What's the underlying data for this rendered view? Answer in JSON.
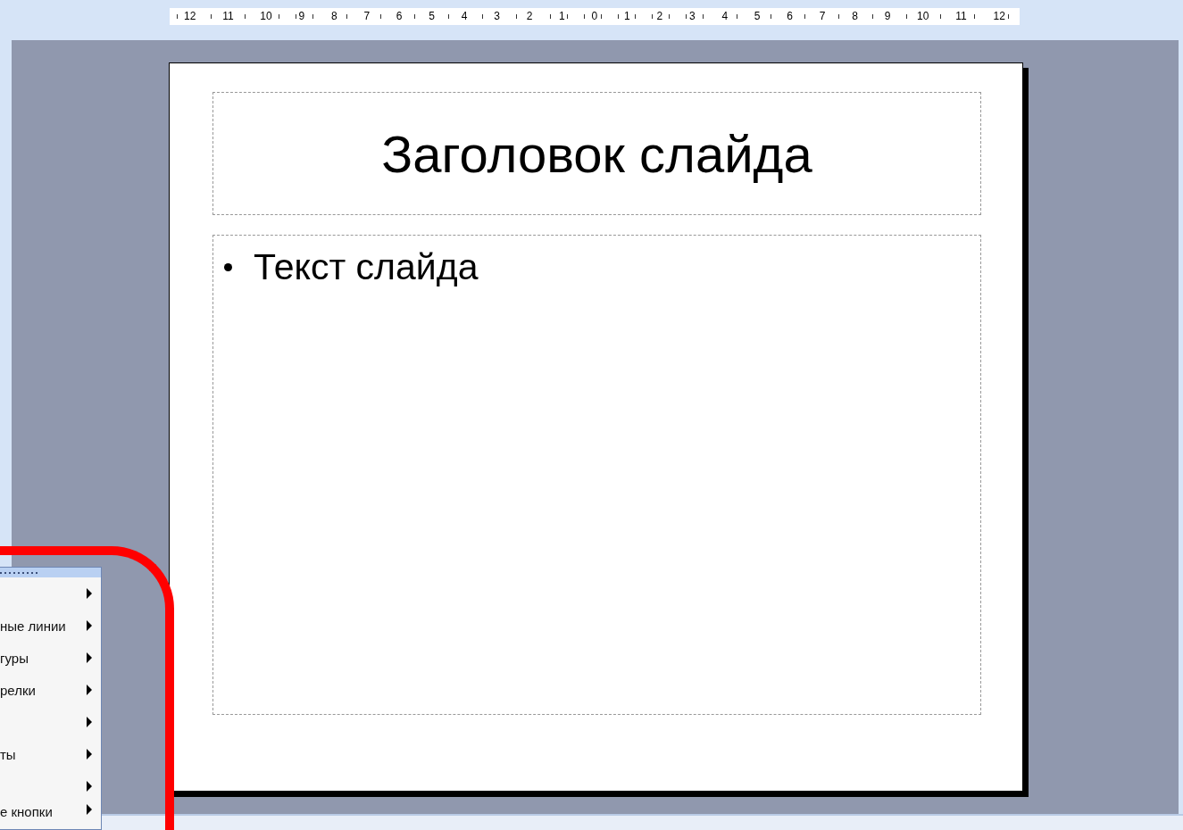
{
  "ruler": {
    "labels": [
      "12",
      "11",
      "10",
      "9",
      "8",
      "7",
      "6",
      "5",
      "4",
      "3",
      "2",
      "1",
      "0",
      "1",
      "2",
      "3",
      "4",
      "5",
      "6",
      "7",
      "8",
      "9",
      "10",
      "11",
      "12"
    ]
  },
  "slide": {
    "title": "Заголовок слайда",
    "bullets": [
      "Текст слайда"
    ]
  },
  "menu": {
    "items": [
      {
        "has_submenu": true
      },
      {
        "label": "ные линии",
        "has_submenu": true
      },
      {
        "label": "гуры",
        "has_submenu": true
      },
      {
        "label": "релки",
        "has_submenu": true
      },
      {
        "has_submenu": true
      },
      {
        "label": "ты",
        "has_submenu": true
      },
      {
        "has_submenu": true
      },
      {
        "label": "е кнопки",
        "has_submenu": true
      }
    ]
  }
}
